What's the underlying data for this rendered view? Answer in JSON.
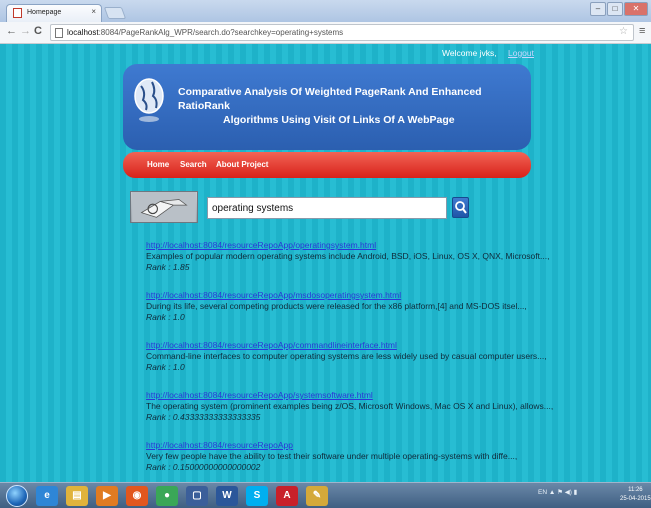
{
  "browser": {
    "tab_title": "Homepage",
    "tab_close": "×",
    "url_host": "localhost",
    "url_rest": ":8084/PageRankAlg_WPR/search.do?searchkey=operating+systems",
    "window_controls": {
      "minimize": "–",
      "maximize": "□",
      "close": "✕"
    },
    "nav": {
      "back": "←",
      "forward": "→",
      "reload": "C"
    },
    "star": "☆",
    "menu": "≡"
  },
  "page": {
    "welcome_text": "Welcome jvks,",
    "logout_label": "Logout",
    "header": {
      "line1": "Comparative Analysis Of Weighted PageRank And Enhanced",
      "line2": "RatioRank",
      "line3": "Algorithms Using Visit Of Links Of A WebPage"
    },
    "menu": {
      "home": "Home",
      "search": "Search",
      "about": "About Project"
    },
    "search": {
      "value": "operating systems"
    },
    "results": [
      {
        "url": "http://localhost:8084/resourceRepoApp/operatingsystem.html",
        "snippet": "Examples of popular modern operating systems include Android, BSD, iOS, Linux, OS X, QNX, Microsoft...,",
        "rank": "Rank : 1.85"
      },
      {
        "url": "http://localhost:8084/resourceRepoApp/msdosoperatingsystem.html",
        "snippet": "During its life, several competing products were released for the x86 platform,[4] and MS-DOS itsel...,",
        "rank": "Rank : 1.0"
      },
      {
        "url": "http://localhost:8084/resourceRepoApp/commandlineinterface.html",
        "snippet": "Command-line interfaces to computer operating systems are less widely used by casual computer users...,",
        "rank": "Rank : 1.0"
      },
      {
        "url": "http://localhost:8084/resourceRepoApp/systemsoftware.html",
        "snippet": "The operating system (prominent examples being z/OS, Microsoft Windows, Mac OS X and Linux), allows...,",
        "rank": "Rank : 0.43333333333333335"
      },
      {
        "url": "http://localhost:8084/resourceRepoApp",
        "snippet": "Very few people have the ability to test their software under multiple operating-systems with diffe...,",
        "rank": "Rank : 0.15000000000000002"
      }
    ]
  },
  "taskbar": {
    "apps": [
      {
        "icon": "internet-explorer-icon",
        "glyph": "e",
        "color": "#2e86d6"
      },
      {
        "icon": "file-explorer-icon",
        "glyph": "▤",
        "color": "#e0b33c"
      },
      {
        "icon": "media-player-icon",
        "glyph": "▶",
        "color": "#e07b22"
      },
      {
        "icon": "firefox-icon",
        "glyph": "◉",
        "color": "#e2571e"
      },
      {
        "icon": "chrome-icon",
        "glyph": "●",
        "color": "#3aa757"
      },
      {
        "icon": "virtualbox-icon",
        "glyph": "▢",
        "color": "#3b5f9a"
      },
      {
        "icon": "word-icon",
        "glyph": "W",
        "color": "#2b579a"
      },
      {
        "icon": "skype-icon",
        "glyph": "S",
        "color": "#00aff0"
      },
      {
        "icon": "acrobat-icon",
        "glyph": "A",
        "color": "#c8202a"
      },
      {
        "icon": "paint-icon",
        "glyph": "✎",
        "color": "#d4a93a"
      }
    ],
    "tray_text": "EN  ▲ ⚑ ◀) ▮",
    "time": "11:26",
    "date": "25-04-2015"
  }
}
